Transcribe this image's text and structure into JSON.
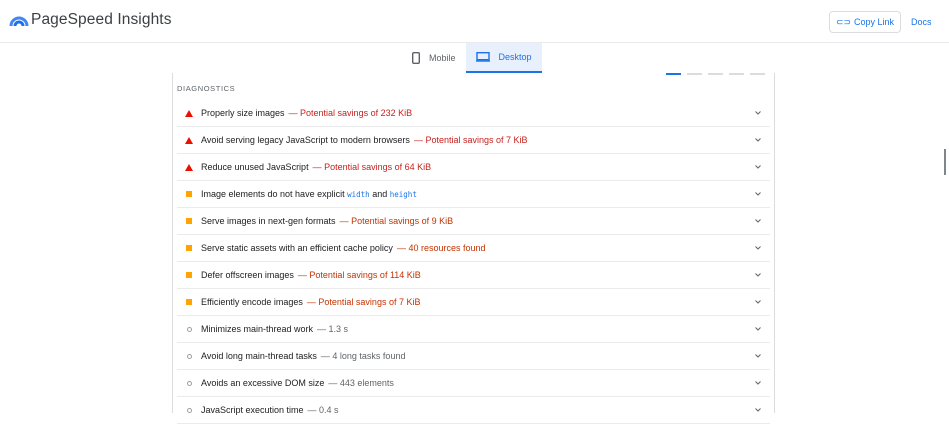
{
  "app": {
    "title": "PageSpeed Insights",
    "copy_link_label": "Copy Link",
    "docs_label": "Docs"
  },
  "tabs": [
    {
      "label": "Mobile",
      "icon": "mobile-icon",
      "active": false
    },
    {
      "label": "Desktop",
      "icon": "desktop-icon",
      "active": true
    }
  ],
  "section": {
    "title": "DIAGNOSTICS"
  },
  "colors": {
    "fail": "#eb0f00",
    "average": "#ffa400",
    "accent": "#1a73e8"
  },
  "audits": [
    {
      "status": "fail",
      "title": "Properly size images",
      "detail": "— Potential savings of 232 KiB"
    },
    {
      "status": "fail",
      "title": "Avoid serving legacy JavaScript to modern browsers",
      "detail": "— Potential savings of 7 KiB"
    },
    {
      "status": "fail",
      "title": "Reduce unused JavaScript",
      "detail": "— Potential savings of 64 KiB"
    },
    {
      "status": "average",
      "title_prefix": "Image elements do not have explicit",
      "code1": "width",
      "and": "and",
      "code2": "height"
    },
    {
      "status": "average",
      "title": "Serve images in next-gen formats",
      "detail": "— Potential savings of 9 KiB"
    },
    {
      "status": "average",
      "title": "Serve static assets with an efficient cache policy",
      "detail": "— 40 resources found"
    },
    {
      "status": "average",
      "title": "Defer offscreen images",
      "detail": "— Potential savings of 114 KiB"
    },
    {
      "status": "average",
      "title": "Efficiently encode images",
      "detail": "— Potential savings of 7 KiB"
    },
    {
      "status": "pass",
      "title": "Minimizes main-thread work",
      "detail": "— 1.3 s"
    },
    {
      "status": "pass",
      "title": "Avoid long main-thread tasks",
      "detail": "— 4 long tasks found"
    },
    {
      "status": "pass",
      "title": "Avoids an excessive DOM size",
      "detail": "— 443 elements"
    },
    {
      "status": "pass",
      "title": "JavaScript execution time",
      "detail": "— 0.4 s"
    }
  ]
}
